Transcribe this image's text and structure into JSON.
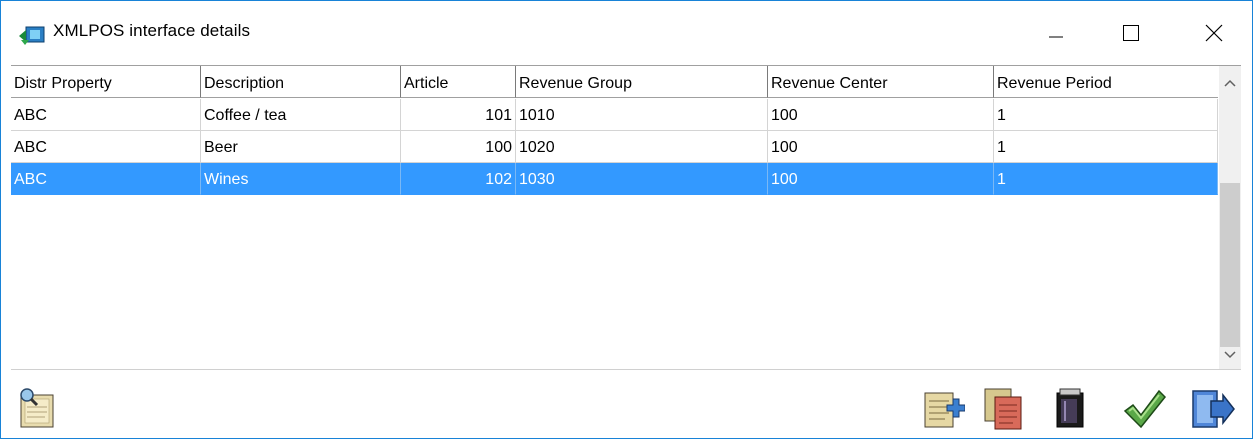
{
  "window": {
    "title": "XMLPOS interface details",
    "controls": [
      "minimize",
      "maximize",
      "close"
    ]
  },
  "table": {
    "columns": [
      "Distr Property",
      "Description",
      "Article",
      "Revenue Group",
      "Revenue Center",
      "Revenue Period"
    ],
    "rows": [
      {
        "distr_property": "ABC",
        "description": "Coffee / tea",
        "article": "101",
        "revenue_group": "1010",
        "revenue_center": "100",
        "revenue_period": "1",
        "selected": false
      },
      {
        "distr_property": "ABC",
        "description": "Beer",
        "article": "100",
        "revenue_group": "1020",
        "revenue_center": "100",
        "revenue_period": "1",
        "selected": false
      },
      {
        "distr_property": "ABC",
        "description": "Wines",
        "article": "102",
        "revenue_group": "1030",
        "revenue_center": "100",
        "revenue_period": "1",
        "selected": true
      }
    ],
    "selection_color": "#3399ff"
  },
  "toolbar": {
    "left": [
      "notes-search-icon"
    ],
    "right": [
      "add-record-icon",
      "copy-record-icon",
      "delete-record-icon",
      "confirm-icon",
      "exit-icon"
    ]
  },
  "colors": {
    "accent": "#1883d7",
    "selection": "#3399ff"
  }
}
